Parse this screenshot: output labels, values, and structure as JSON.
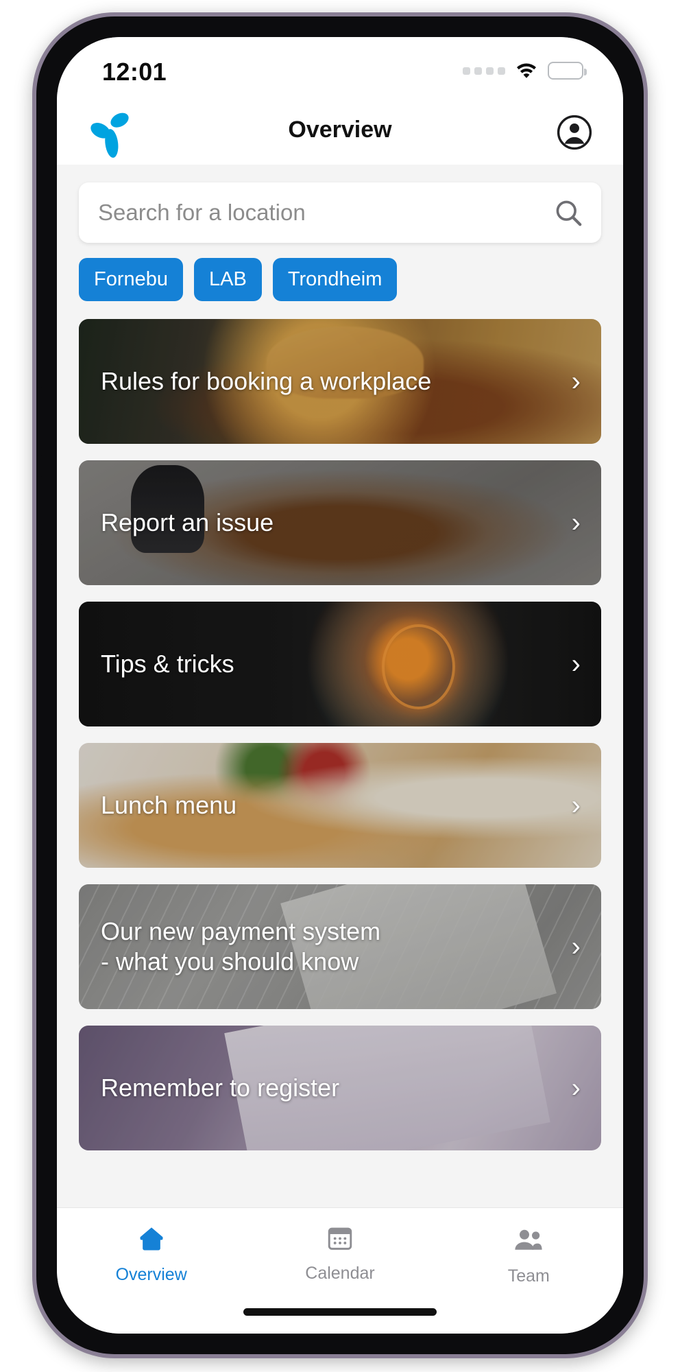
{
  "status_bar": {
    "time": "12:01",
    "signal_icon": "signal-dots-icon",
    "wifi_icon": "wifi-icon",
    "battery_icon": "battery-icon"
  },
  "header": {
    "logo_icon": "telenor-logo-icon",
    "title": "Overview",
    "profile_icon": "account-circle-icon"
  },
  "search": {
    "placeholder": "Search for a location",
    "value": "",
    "icon": "search-icon"
  },
  "chips": [
    {
      "label": "Fornebu",
      "color": "#1581d6"
    },
    {
      "label": "LAB",
      "color": "#1581d6"
    },
    {
      "label": "Trondheim",
      "color": "#1581d6"
    }
  ],
  "cards": [
    {
      "title": "Rules for booking a workplace",
      "chevron": "›",
      "art": "art-workplace"
    },
    {
      "title": "Report an issue",
      "chevron": "›",
      "art": "art-issue"
    },
    {
      "title": "Tips & tricks",
      "chevron": "›",
      "art": "art-tips"
    },
    {
      "title": "Lunch menu",
      "chevron": "›",
      "art": "art-lunch"
    },
    {
      "title": "Our new payment system\n- what you should know",
      "chevron": "›",
      "art": "art-payment"
    },
    {
      "title": "Remember to register",
      "chevron": "›",
      "art": "art-register"
    }
  ],
  "tabs": [
    {
      "label": "Overview",
      "icon": "home-icon",
      "active": true,
      "color": "#1581d6"
    },
    {
      "label": "Calendar",
      "icon": "calendar-icon",
      "active": false,
      "color": "#8e8e93"
    },
    {
      "label": "Team",
      "icon": "people-icon",
      "active": false,
      "color": "#8e8e93"
    }
  ]
}
